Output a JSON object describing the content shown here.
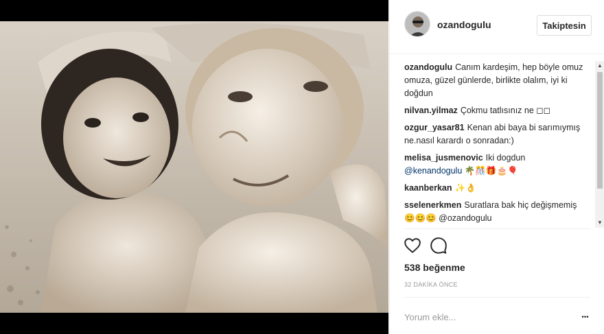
{
  "post": {
    "author": "ozandogulu",
    "follow_label": "Takiptesin",
    "likes": "538 beğenme",
    "time_ago": "32 DAKİKA ÖNCE",
    "comment_placeholder": "Yorum ekle...",
    "more_label": "..."
  },
  "comments": [
    {
      "user": "ozandogulu",
      "text": "Canım kardeşim, hep böyle omuz omuza, güzel günlerde, birlikte olalım, iyi ki doğdun"
    },
    {
      "user": "nilvan.yilmaz",
      "text": "Çokmu tatlısınız ne ◻◻"
    },
    {
      "user": "ozgur_yasar81",
      "text": "Kenan abi baya bi sarımıymış ne.nasıl karardı o sonradan:)"
    },
    {
      "user": "melisa_jusmenovic",
      "text": "Iki dogdun",
      "mention": "@kenandogulu",
      "emoji": "🌴🎊🎁🎂🎈"
    },
    {
      "user": "kaanberkan",
      "text": "✨👌"
    },
    {
      "user": "sselenerkmen",
      "text": "Suratlara bak hiç değişmemiş 😊😊😊 @ozandogulu"
    }
  ],
  "icons": {
    "heart": "heart-icon",
    "comment": "comment-icon",
    "scroll_up": "▲",
    "scroll_down": "▼"
  },
  "colors": {
    "username": "#262626",
    "mention": "#003569",
    "muted": "#999999",
    "border": "#efefef"
  }
}
